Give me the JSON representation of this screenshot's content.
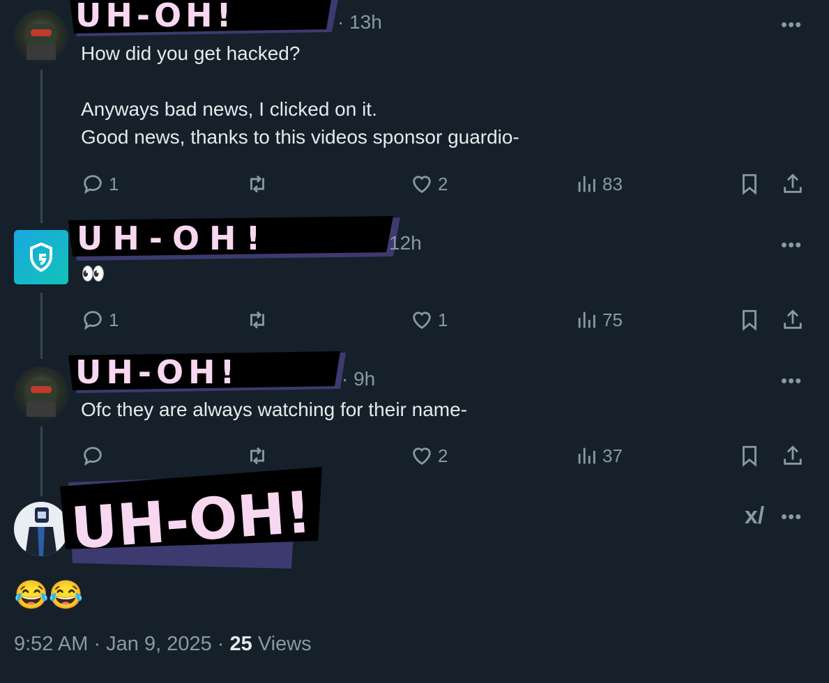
{
  "tweets": [
    {
      "name_banner": "UH-OH!",
      "time": "· 13h",
      "text": "How did you get hacked?\n\nAnyways bad news, I clicked on it.\nGood news, thanks to this videos sponsor guardio-",
      "replies": "1",
      "likes": "2",
      "views": "83"
    },
    {
      "name_banner": "UH-OH!",
      "time": "12h",
      "text": "👀",
      "replies": "1",
      "likes": "1",
      "views": "75"
    },
    {
      "name_banner": "UH-OH!",
      "time": "· 9h",
      "text": "Ofc they are always watching for their name-",
      "replies": "",
      "likes": "2",
      "views": "37"
    }
  ],
  "main_post": {
    "name_banner": "UH-OH!",
    "text": "😂😂",
    "time": "9:52 AM · Jan 9, 2025 · ",
    "views_count": "25",
    "views_label": " Views"
  },
  "more_label": "•••",
  "grok_label": "x/",
  "colors": {
    "background": "#15202b",
    "text": "#e7e9ea",
    "muted": "#8b98a5",
    "banner_fill": "#000000",
    "banner_text": "#f8d7f0",
    "banner_shadow": "#3c3a6e",
    "guardio_teal": "#15b5c8"
  },
  "icons": [
    "reply-icon",
    "retweet-icon",
    "like-icon",
    "views-icon",
    "bookmark-icon",
    "share-icon",
    "more-icon",
    "grok-icon"
  ]
}
